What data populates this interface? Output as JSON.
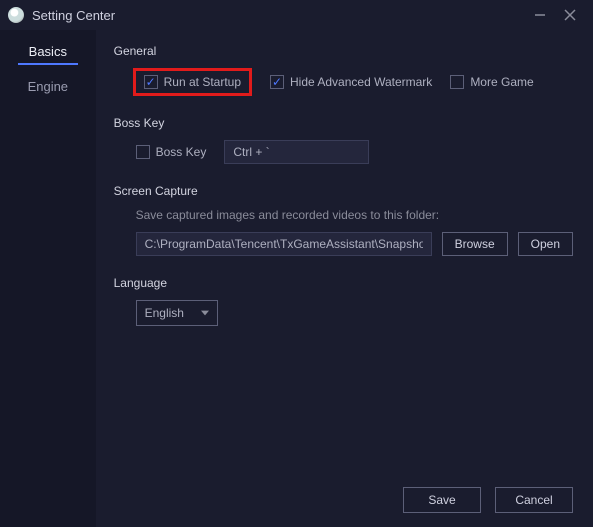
{
  "window": {
    "title": "Setting Center"
  },
  "sidebar": {
    "items": [
      {
        "label": "Basics"
      },
      {
        "label": "Engine"
      }
    ]
  },
  "general": {
    "title": "General",
    "run_at_startup": "Run at Startup",
    "hide_watermark": "Hide Advanced Watermark",
    "more_game": "More Game"
  },
  "bosskey": {
    "title": "Boss Key",
    "label": "Boss Key",
    "value": "Ctrl + `"
  },
  "screencap": {
    "title": "Screen Capture",
    "helper": "Save captured images and recorded videos to this folder:",
    "path": "C:\\ProgramData\\Tencent\\TxGameAssistant\\Snapshot",
    "browse": "Browse",
    "open": "Open"
  },
  "language": {
    "title": "Language",
    "selected": "English"
  },
  "footer": {
    "save": "Save",
    "cancel": "Cancel"
  }
}
